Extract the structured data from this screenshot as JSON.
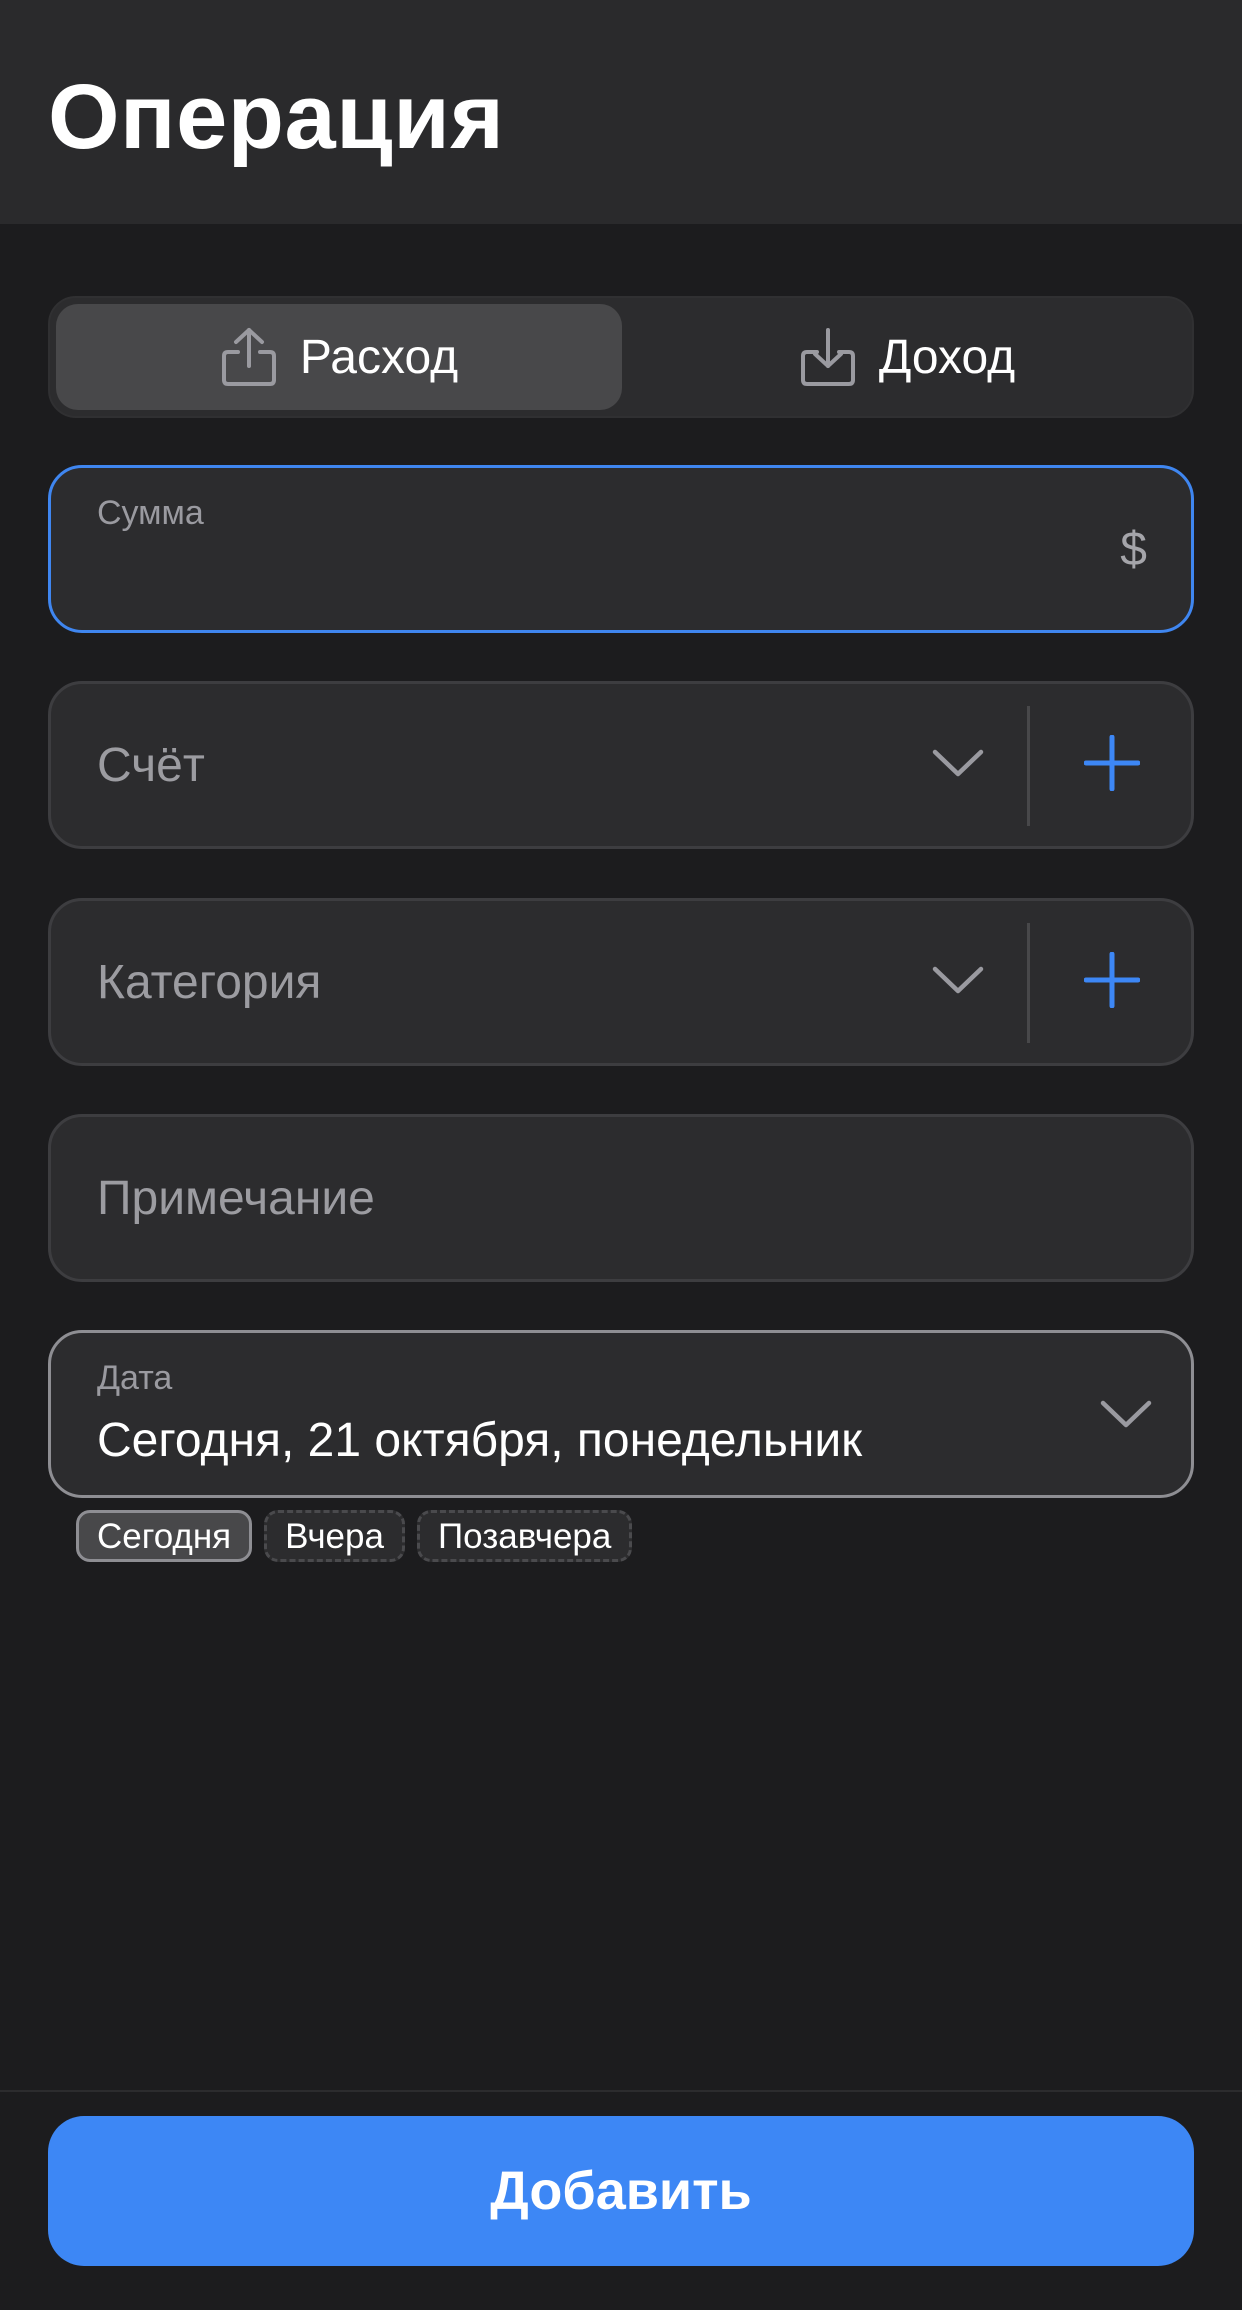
{
  "header": {
    "title": "Операция"
  },
  "type_switch": {
    "expense_label": "Расход",
    "income_label": "Доход",
    "selected": "expense"
  },
  "amount": {
    "label": "Сумма",
    "value": "",
    "currency": "$"
  },
  "account": {
    "placeholder": "Счёт"
  },
  "category": {
    "placeholder": "Категория"
  },
  "note": {
    "placeholder": "Примечание"
  },
  "date": {
    "label": "Дата",
    "value": "Сегодня, 21 октября, понедельник",
    "quick_options": [
      "Сегодня",
      "Вчера",
      "Позавчера"
    ],
    "selected_option": "Сегодня"
  },
  "footer": {
    "add_label": "Добавить"
  },
  "colors": {
    "accent": "#3d87f5",
    "background": "#1c1c1e",
    "surface": "#2c2c2e"
  }
}
